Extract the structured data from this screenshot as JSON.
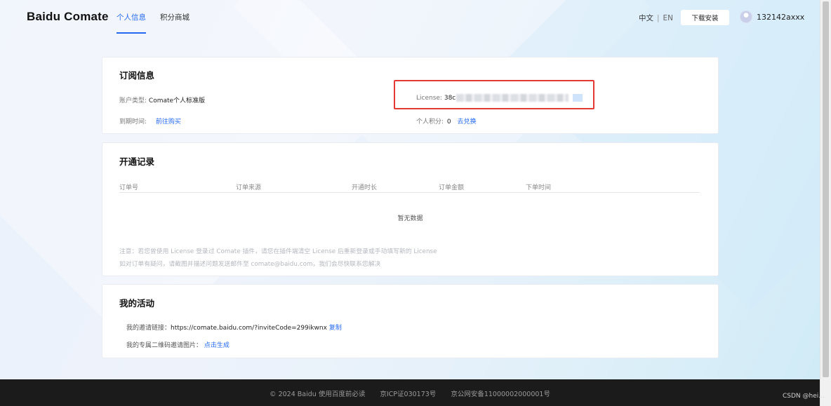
{
  "header": {
    "brand": "Baidu Comate",
    "nav": [
      "个人信息",
      "积分商城"
    ],
    "lang_zh": "中文",
    "lang_sep": "|",
    "lang_en": "EN",
    "download_label": "下载安装",
    "username": "132142axxx"
  },
  "subscription": {
    "title": "订阅信息",
    "account_type_label": "账户类型:",
    "account_type_value": "Comate个人标准版",
    "expire_label": "到期时间:",
    "expire_link": "前往购买",
    "license_label": "License:",
    "license_value": "38c",
    "points_label": "个人积分:",
    "points_value": "0",
    "points_link": "去兑换"
  },
  "records": {
    "title": "开通记录",
    "columns": [
      "订单号",
      "订单来源",
      "开通时长",
      "订单金额",
      "下单时间"
    ],
    "empty_text": "暂无数据",
    "note1": "注意：若您曾使用 License 登录过 Comate 插件，请您在插件端清空 License 后重新登录或手动填写新的 License",
    "note2": "如对订单有疑问，请截图并描述问题发送邮件至 comate@baidu.com，我们会尽快联系您解决"
  },
  "activity": {
    "title": "我的活动",
    "invite_label": "我的邀请链接：",
    "invite_url": "https://comate.baidu.com/?inviteCode=299ikwnx",
    "copy_link": "复制",
    "qr_label": "我的专属二维码邀请图片：",
    "qr_link": "点击生成"
  },
  "footer": {
    "copyright": "© 2024 Baidu 使用百度前必读",
    "icp": "京ICP证030173号",
    "police": "京公网安备11000002000001号",
    "watermark": "CSDN @hei..."
  },
  "colors": {
    "accent": "#2468f2",
    "highlight": "#e53935",
    "footer_bg": "#1b1b1b"
  }
}
